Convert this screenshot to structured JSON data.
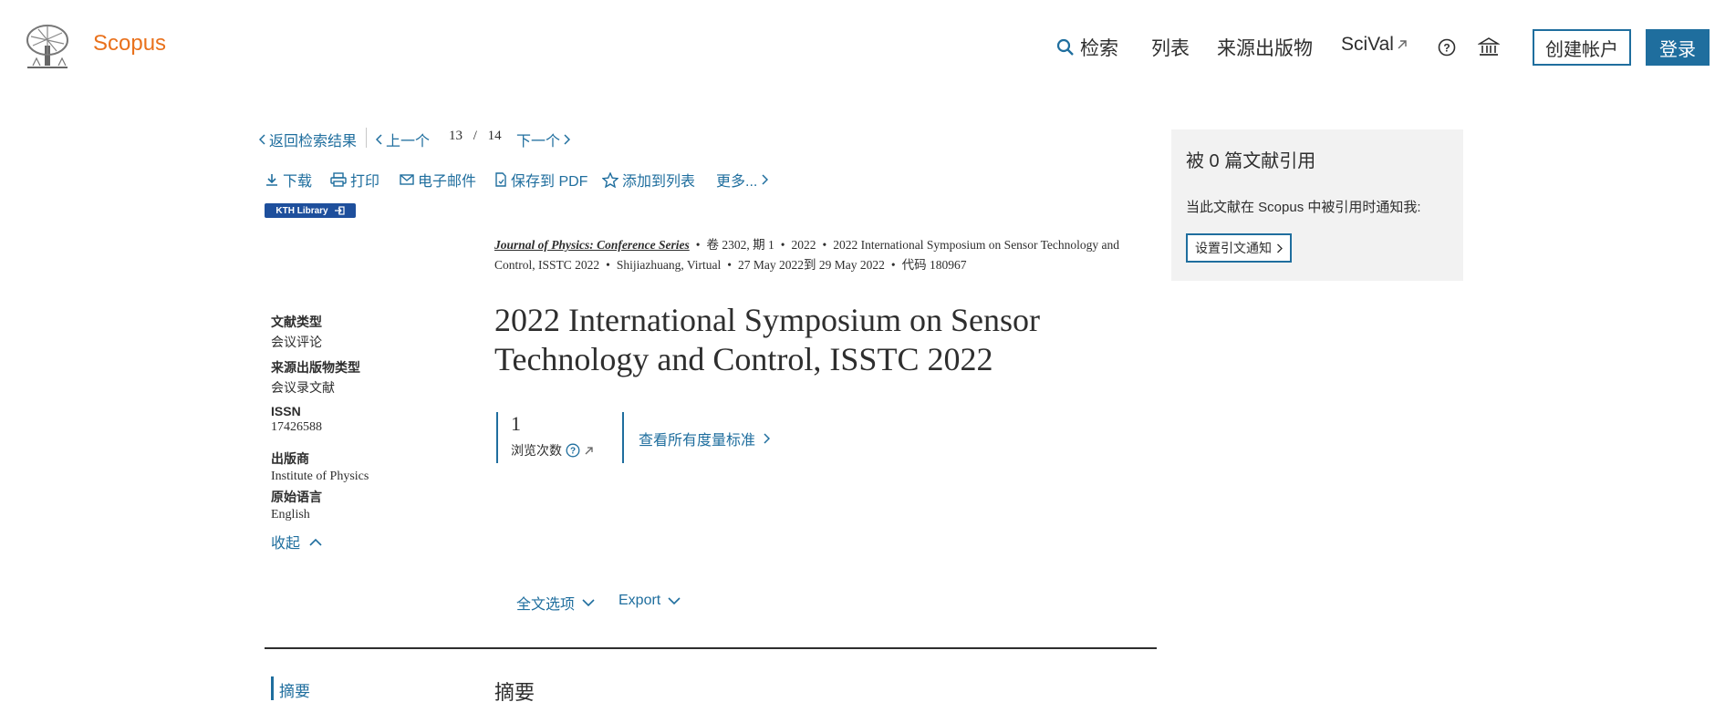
{
  "header": {
    "brand": "Scopus",
    "nav": {
      "search": "检索",
      "lists": "列表",
      "sources": "来源出版物",
      "scival": "SciVal"
    },
    "create_account": "创建帐户",
    "login": "登录"
  },
  "pager": {
    "back": "返回检索结果",
    "prev": "上一个",
    "current": "13",
    "separator": "/",
    "total": "14",
    "next": "下一个"
  },
  "toolbar": {
    "download": "下载",
    "print": "打印",
    "email": "电子邮件",
    "save_pdf": "保存到 PDF",
    "add_to_list": "添加到列表",
    "more": "更多..."
  },
  "library_badge": "KTH Library",
  "source": {
    "journal": "Journal of Physics: Conference Series",
    "volume": "卷 2302, 期 1",
    "year": "2022",
    "conference": "2022 International Symposium on Sensor Technology and Control, ISSTC 2022",
    "location": "Shijiazhuang, Virtual",
    "dates": "27 May 2022到 29 May 2022",
    "code": "代码 180967"
  },
  "title": "2022 International Symposium on Sensor Technology and Control, ISSTC 2022",
  "metadata": {
    "doc_type_label": "文献类型",
    "doc_type_value": "会议评论",
    "source_type_label": "来源出版物类型",
    "source_type_value": "会议录文献",
    "issn_label": "ISSN",
    "issn_value": "17426588",
    "publisher_label": "出版商",
    "publisher_value": "Institute of Physics",
    "language_label": "原始语言",
    "language_value": "English",
    "collapse": "收起"
  },
  "metrics": {
    "views_value": "1",
    "views_label": "浏览次数",
    "all_metrics": "查看所有度量标准"
  },
  "actions": {
    "full_text": "全文选项",
    "export": "Export"
  },
  "citations": {
    "title": "被 0 篇文献引用",
    "notify_text": "当此文献在 Scopus 中被引用时通知我:",
    "alert_button": "设置引文通知"
  },
  "abstract": {
    "nav_label": "摘要",
    "heading": "摘要"
  },
  "colors": {
    "brand": "#e9711c",
    "link": "#1f6e9e",
    "panel_bg": "#f2f2f2",
    "badge_bg": "#1e4f9c"
  }
}
